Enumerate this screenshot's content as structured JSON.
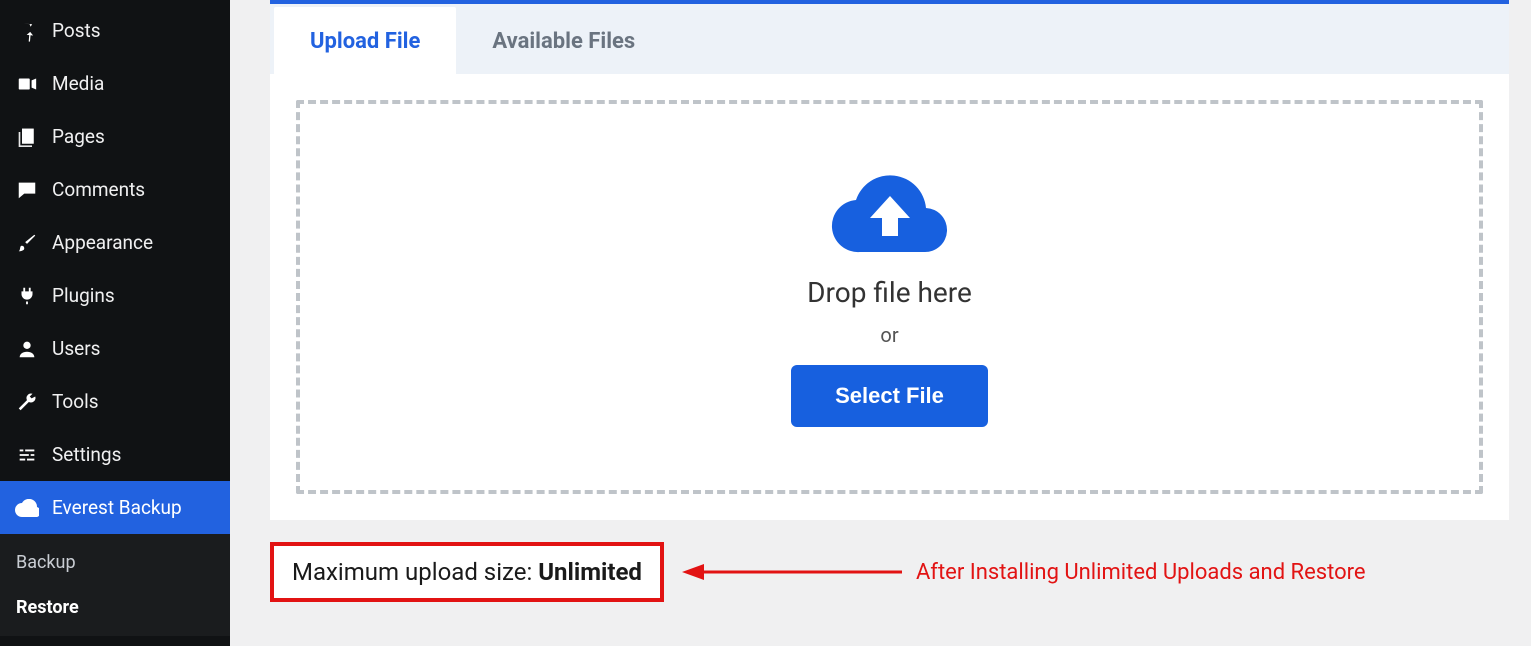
{
  "sidebar": {
    "items": [
      {
        "icon": "pin",
        "label": "Posts"
      },
      {
        "icon": "media",
        "label": "Media"
      },
      {
        "icon": "page",
        "label": "Pages"
      },
      {
        "icon": "comment",
        "label": "Comments"
      },
      {
        "icon": "brush",
        "label": "Appearance"
      },
      {
        "icon": "plug",
        "label": "Plugins"
      },
      {
        "icon": "user",
        "label": "Users"
      },
      {
        "icon": "wrench",
        "label": "Tools"
      },
      {
        "icon": "sliders",
        "label": "Settings"
      },
      {
        "icon": "cloud",
        "label": "Everest Backup"
      }
    ],
    "active_index": 9,
    "submenu": [
      {
        "label": "Backup"
      },
      {
        "label": "Restore",
        "current": true
      }
    ]
  },
  "tabs": {
    "items": [
      {
        "label": "Upload File"
      },
      {
        "label": "Available Files"
      }
    ],
    "active_index": 0
  },
  "dropzone": {
    "title": "Drop file here",
    "or": "or",
    "button": "Select File"
  },
  "maxrow": {
    "prefix": "Maximum upload size: ",
    "value": "Unlimited"
  },
  "annotation": "After Installing Unlimited Uploads and Restore"
}
